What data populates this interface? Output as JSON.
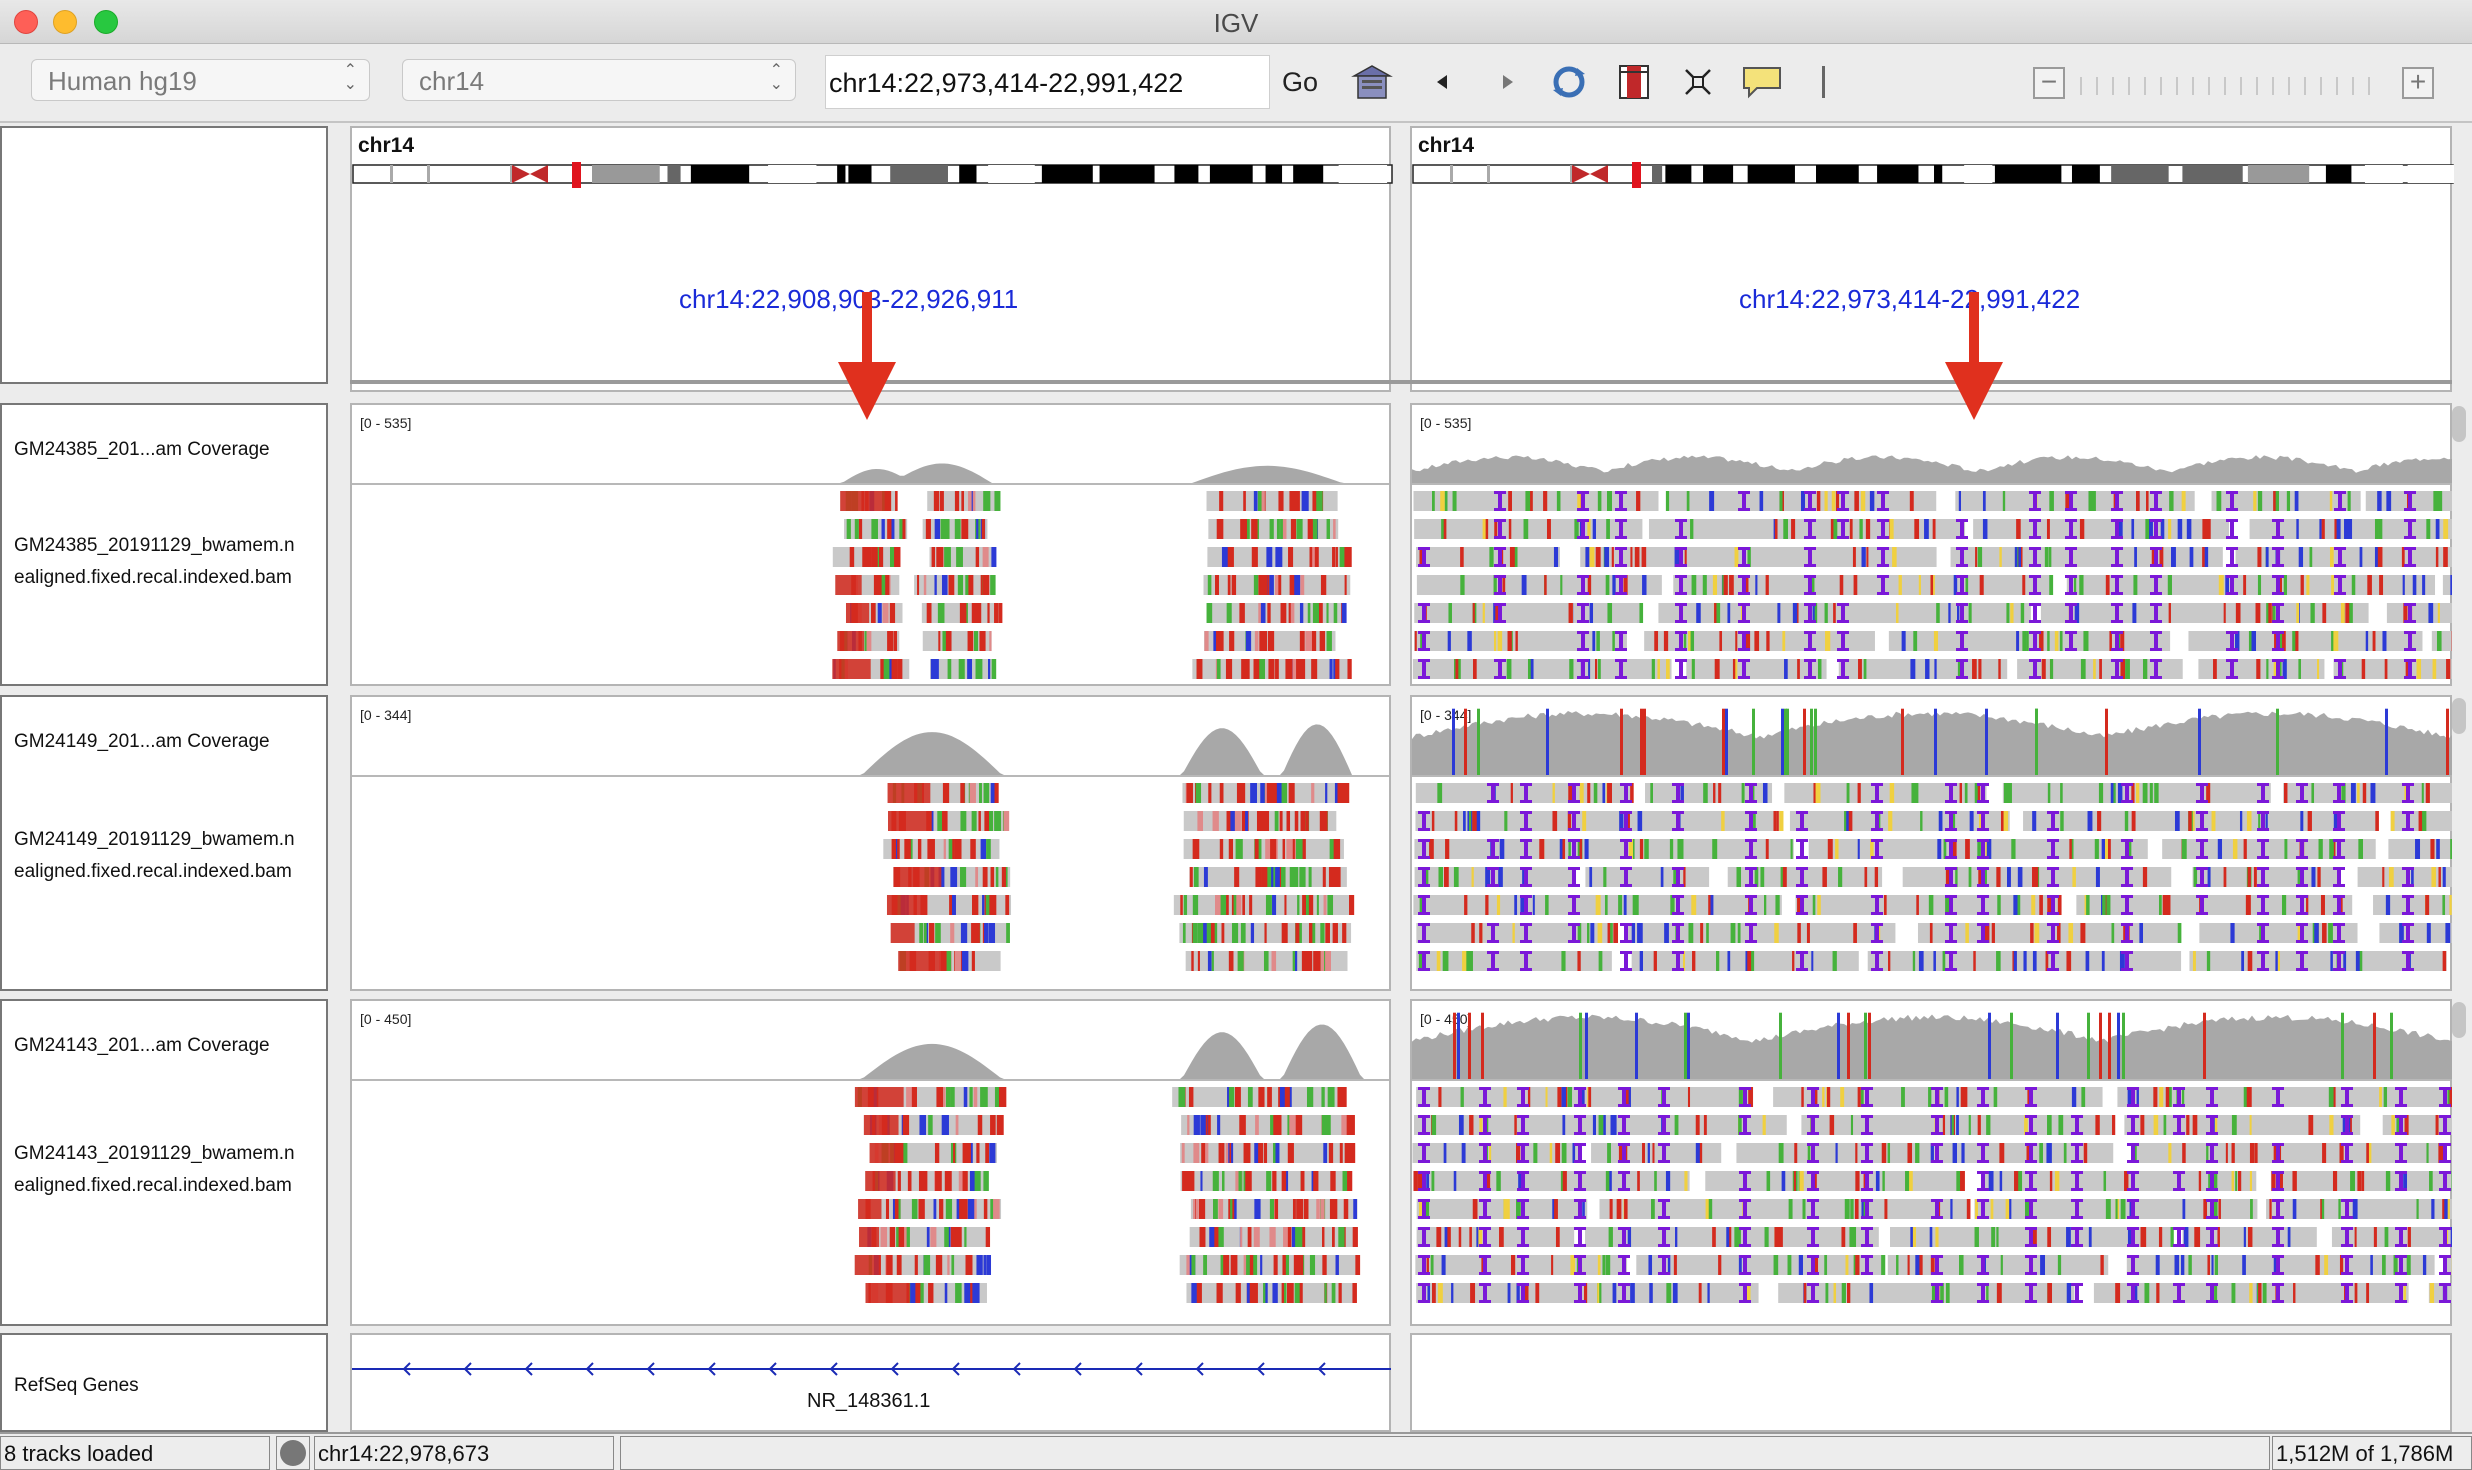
{
  "window": {
    "title": "IGV"
  },
  "toolbar": {
    "genome": "Human hg19",
    "chromosome": "chr14",
    "locus": "chr14:22,973,414-22,991,422",
    "go_label": "Go",
    "icons": [
      "home-icon",
      "back-icon",
      "forward-icon",
      "refresh-icon",
      "roi-icon",
      "resize-icon",
      "popup-info-icon",
      "zoom-out-icon",
      "zoom-in-icon"
    ]
  },
  "ideogram": {
    "left": {
      "chromosome": "chr14",
      "locus": "chr14:22,908,903-22,926,911"
    },
    "right": {
      "chromosome": "chr14",
      "locus": "chr14:22,973,414-22,991,422"
    }
  },
  "tracks": [
    {
      "coverage_name": "GM24385_201...am Coverage",
      "bam_line1": "GM24385_20191129_bwamem.n",
      "bam_line2": "ealigned.fixed.recal.indexed.bam",
      "range": "[0 - 535]"
    },
    {
      "coverage_name": "GM24149_201...am Coverage",
      "bam_line1": "GM24149_20191129_bwamem.n",
      "bam_line2": "ealigned.fixed.recal.indexed.bam",
      "range": "[0 - 344]"
    },
    {
      "coverage_name": "GM24143_201...am Coverage",
      "bam_line1": "GM24143_20191129_bwamem.n",
      "bam_line2": "ealigned.fixed.recal.indexed.bam",
      "range": "[0 - 450]"
    }
  ],
  "genes": {
    "track_name": "RefSeq Genes",
    "gene_label": "NR_148361.1"
  },
  "status": {
    "tracks_loaded": "8 tracks loaded",
    "position": "chr14:22,978,673",
    "memory": "1,512M of 1,786M"
  },
  "colors": {
    "mismatch_red": "#d42a1e",
    "mismatch_green": "#46b23c",
    "mismatch_blue": "#2c3ad6",
    "insertion_purple": "#7b18d8",
    "read_gray": "#c9c9c9",
    "coverage_gray": "#a8a8a8",
    "locus_blue": "#1a2ad8",
    "arrow_red": "#e0301e"
  }
}
